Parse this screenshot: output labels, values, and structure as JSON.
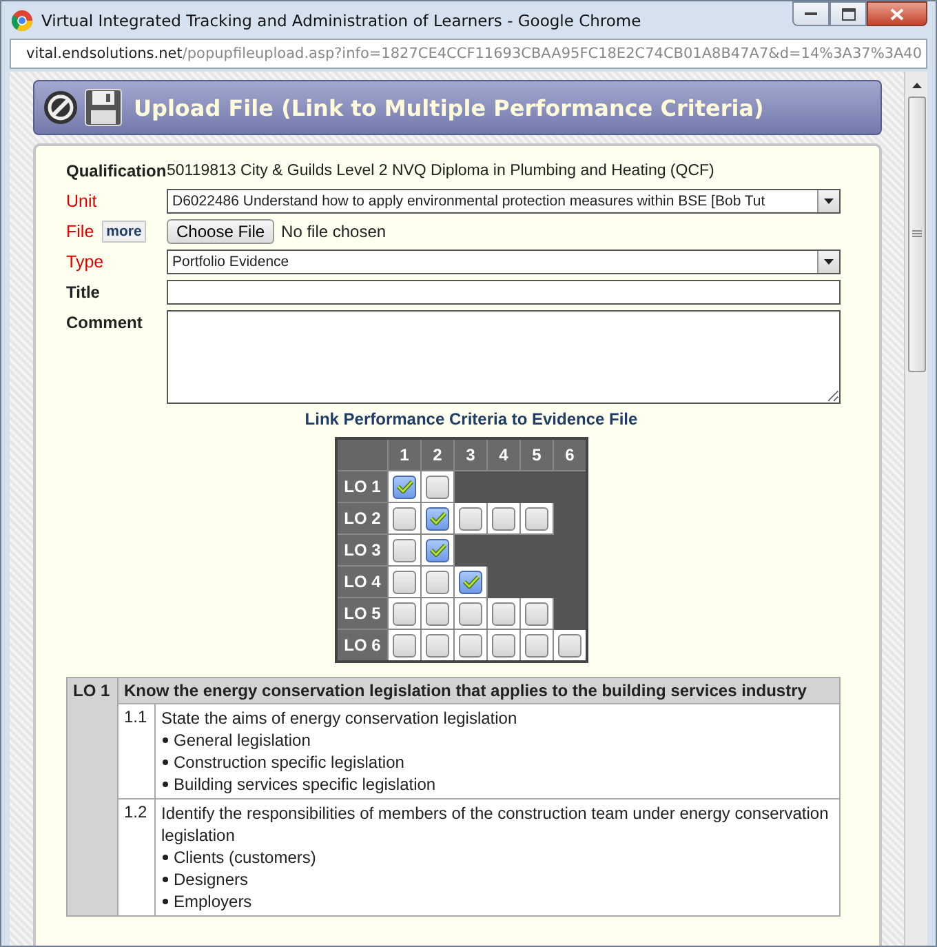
{
  "window": {
    "title": "Virtual Integrated Tracking and Administration of Learners - Google Chrome"
  },
  "address_bar": {
    "domain": "vital.endsolutions.net",
    "path": "/popupfileupload.asp?info=1827CE4CCF11693CBAA95FC18E2C74CB01A8B47A7&d=14%3A37%3A40"
  },
  "header": {
    "title": "Upload File (Link to Multiple Performance Criteria)"
  },
  "fields": [
    {
      "kind": "text",
      "label": "Qualification",
      "required": false,
      "value": "50119813 City & Guilds Level 2 NVQ Diploma in Plumbing and Heating (QCF)"
    },
    {
      "kind": "select",
      "label": "Unit",
      "required": true,
      "value": "D6022486 Understand how to apply environmental protection measures within BSE [Bob Tut"
    },
    {
      "kind": "file",
      "label": "File",
      "required": true,
      "more": "more",
      "button": "Choose File",
      "status": "No file chosen"
    },
    {
      "kind": "select",
      "label": "Type",
      "required": true,
      "value": "Portfolio Evidence"
    },
    {
      "kind": "input",
      "label": "Title",
      "required": false
    },
    {
      "kind": "textarea",
      "label": "Comment",
      "required": false
    }
  ],
  "grid": {
    "title": "Link Performance Criteria to Evidence File",
    "columns": [
      "1",
      "2",
      "3",
      "4",
      "5",
      "6"
    ],
    "rows": [
      {
        "label": "LO 1",
        "cells": [
          {
            "checked": true
          },
          {
            "checked": false
          }
        ]
      },
      {
        "label": "LO 2",
        "cells": [
          {
            "checked": false
          },
          {
            "checked": true
          },
          {
            "checked": false
          },
          {
            "checked": false
          },
          {
            "checked": false
          }
        ]
      },
      {
        "label": "LO 3",
        "cells": [
          {
            "checked": false
          },
          {
            "checked": true
          }
        ]
      },
      {
        "label": "LO 4",
        "cells": [
          {
            "checked": false
          },
          {
            "checked": false
          },
          {
            "checked": true
          }
        ]
      },
      {
        "label": "LO 5",
        "cells": [
          {
            "checked": false
          },
          {
            "checked": false
          },
          {
            "checked": false
          },
          {
            "checked": false
          },
          {
            "checked": false
          }
        ]
      },
      {
        "label": "LO 6",
        "cells": [
          {
            "checked": false
          },
          {
            "checked": false
          },
          {
            "checked": false
          },
          {
            "checked": false
          },
          {
            "checked": false
          },
          {
            "checked": false
          }
        ]
      }
    ]
  },
  "outcomes": [
    {
      "label": "LO 1",
      "title": "Know the energy conservation legislation that applies to the building services industry",
      "criteria": [
        {
          "number": "1.1",
          "text": "State the aims of energy conservation legislation",
          "points": [
            "General legislation",
            "Construction specific legislation",
            "Building services specific legislation"
          ]
        },
        {
          "number": "1.2",
          "text": "Identify the responsibilities of members of the construction team under energy conservation legislation",
          "points": [
            "Clients (customers)",
            "Designers",
            "Employers"
          ]
        }
      ]
    }
  ]
}
